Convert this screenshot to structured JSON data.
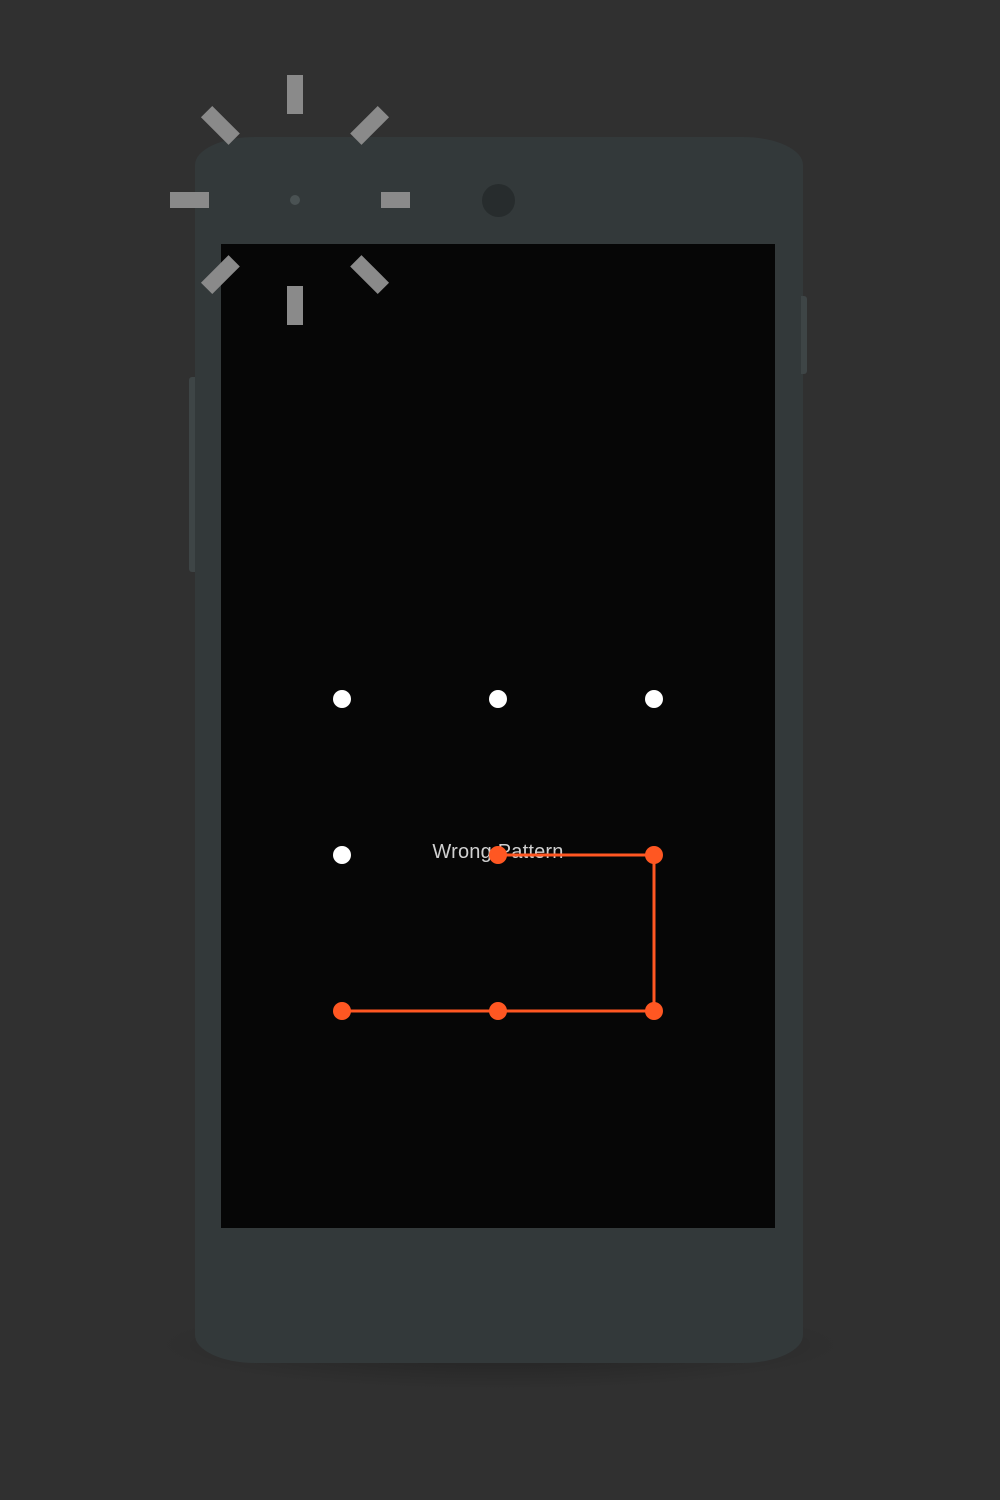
{
  "lock_screen": {
    "status_text": "Wrong Pattern",
    "status_color": "#d0d0d0",
    "screen_background": "#060606"
  },
  "pattern_grid": {
    "rows": 3,
    "cols": 3,
    "idle_dot_color": "#ffffff",
    "error_color": "#ff5722",
    "selected_sequence": [
      5,
      6,
      9,
      8,
      7
    ]
  },
  "device": {
    "body_color": "#33393a",
    "notification_icon": "alert-burst-icon",
    "notification_color": "#8a8a8a"
  }
}
